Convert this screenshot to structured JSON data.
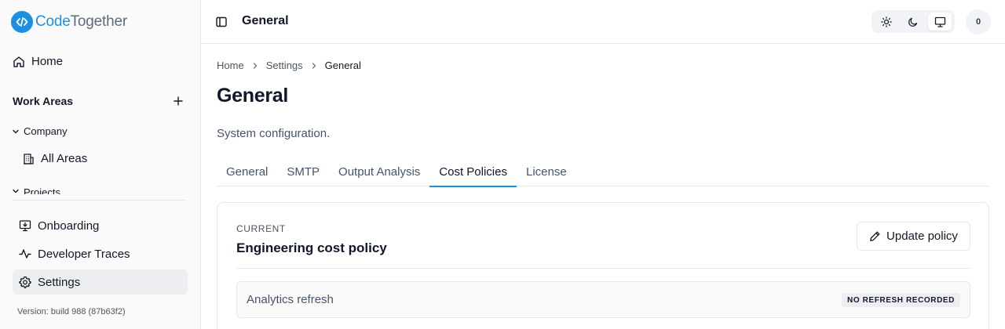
{
  "app": {
    "logo_part1": "Code",
    "logo_part2": "Together"
  },
  "sidebar": {
    "home_label": "Home",
    "work_areas_title": "Work Areas",
    "groups": [
      {
        "label": "Company",
        "items": [
          {
            "label": "All Areas"
          }
        ]
      },
      {
        "label": "Projects"
      }
    ],
    "bottom_items": [
      {
        "label": "Onboarding"
      },
      {
        "label": "Developer Traces"
      },
      {
        "label": "Settings",
        "active": true
      }
    ],
    "version": "Version: build 988 (87b63f2)"
  },
  "header": {
    "title": "General",
    "theme_options": [
      "light",
      "dark",
      "system"
    ],
    "theme_selected": "system",
    "avatar_initial": "0"
  },
  "breadcrumb": [
    "Home",
    "Settings",
    "General"
  ],
  "page": {
    "title": "General",
    "description": "System configuration."
  },
  "tabs": [
    {
      "label": "General"
    },
    {
      "label": "SMTP"
    },
    {
      "label": "Output Analysis"
    },
    {
      "label": "Cost Policies",
      "active": true
    },
    {
      "label": "License"
    }
  ],
  "card": {
    "eyebrow": "CURRENT",
    "title": "Engineering cost policy",
    "update_button": "Update policy",
    "rows": [
      {
        "label": "Analytics refresh",
        "badge": "NO REFRESH RECORDED"
      }
    ]
  },
  "colors": {
    "accent": "#1d8fe1",
    "logo_secondary": "#5f6b7a"
  }
}
